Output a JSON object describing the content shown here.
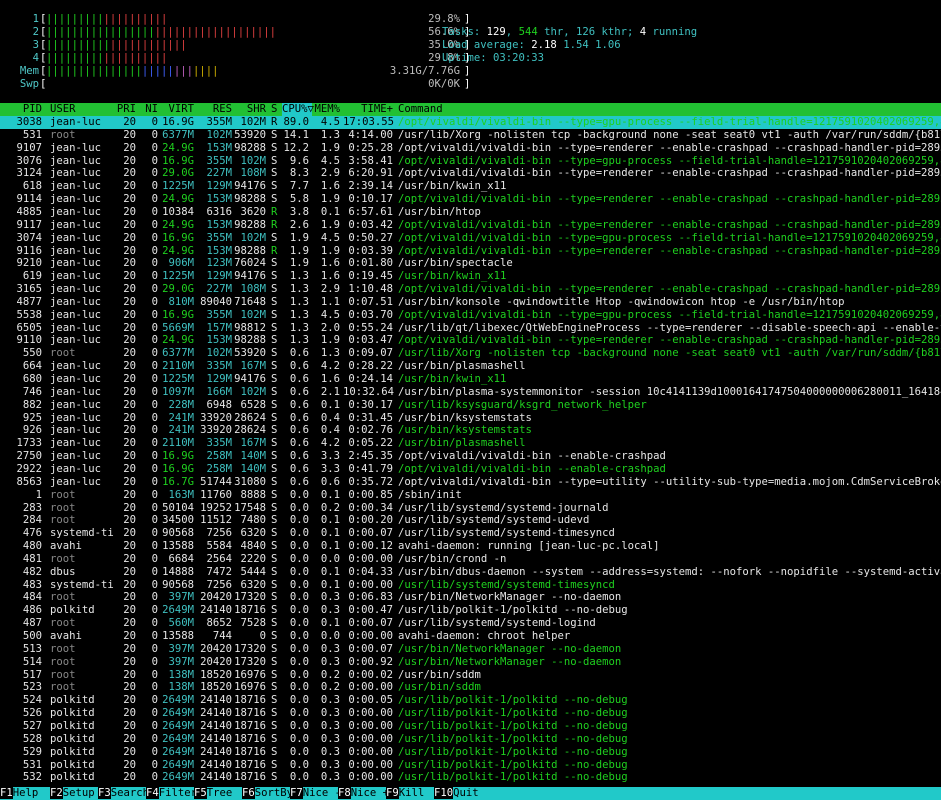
{
  "meters": [
    {
      "label": "1",
      "value": "29.8%"
    },
    {
      "label": "2",
      "value": "56.6%"
    },
    {
      "label": "3",
      "value": "35.0%"
    },
    {
      "label": "4",
      "value": "29.8%"
    },
    {
      "label": "Mem",
      "value": "3.31G/7.76G"
    },
    {
      "label": "Swp",
      "value": "0K/0K"
    }
  ],
  "meter_levels": [
    0.298,
    0.566,
    0.35,
    0.298,
    0.426,
    0.0
  ],
  "stats": {
    "tasks_label": "Tasks: ",
    "tasks": "129",
    "sep1": ", ",
    "thr": "544",
    "thr_label": " thr, ",
    "kthr": "126 kthr; ",
    "running": "4",
    "running_label": " running",
    "load_label": "Load average: ",
    "load1": "2.18",
    "load5": "1.54",
    "load15": "1.06",
    "uptime_label": "Uptime: ",
    "uptime": "03:20:33"
  },
  "header": {
    "pid": "PID",
    "user": "USER",
    "pri": "PRI",
    "ni": "NI",
    "virt": "VIRT",
    "res": "RES",
    "shr": "SHR",
    "s": "S",
    "cpu": "CPU%▽",
    "mem": "MEM%",
    "time": "TIME+",
    "cmd": "Command"
  },
  "processes": [
    [
      "3038",
      "jean-luc",
      "20",
      "0",
      "16.9G",
      "355M",
      "102M",
      "R",
      "89.0",
      "4.5",
      "17:03.55",
      "/opt/vivaldi/vivaldi-bin --type=gpu-process --field-trial-handle=1217591020402069259,8574",
      1
    ],
    [
      "531",
      "root",
      "20",
      "0",
      "6377M",
      "102M",
      "53920",
      "S",
      "14.1",
      "1.3",
      "4:14.00",
      "/usr/lib/Xorg -nolisten tcp -background none -seat seat0 vt1 -auth /var/run/sddm/{b817b8c",
      0
    ],
    [
      "9107",
      "jean-luc",
      "20",
      "0",
      "24.9G",
      "153M",
      "98288",
      "S",
      "12.2",
      "1.9",
      "0:25.28",
      "/opt/vivaldi/vivaldi-bin --type=renderer --enable-crashpad --crashpad-handler-pid=2895 --",
      0
    ],
    [
      "3076",
      "jean-luc",
      "20",
      "0",
      "16.9G",
      "355M",
      "102M",
      "S",
      "9.6",
      "4.5",
      "3:58.41",
      "/opt/vivaldi/vivaldi-bin --type=gpu-process --field-trial-handle=1217591020402069259,8574",
      1
    ],
    [
      "3124",
      "jean-luc",
      "20",
      "0",
      "29.0G",
      "227M",
      "108M",
      "S",
      "8.3",
      "2.9",
      "6:20.91",
      "/opt/vivaldi/vivaldi-bin --type=renderer --enable-crashpad --crashpad-handler-pid=2895 --",
      0
    ],
    [
      "618",
      "jean-luc",
      "20",
      "0",
      "1225M",
      "129M",
      "94176",
      "S",
      "7.7",
      "1.6",
      "2:39.14",
      "/usr/bin/kwin_x11",
      0
    ],
    [
      "9114",
      "jean-luc",
      "20",
      "0",
      "24.9G",
      "153M",
      "98288",
      "S",
      "5.8",
      "1.9",
      "0:10.17",
      "/opt/vivaldi/vivaldi-bin --type=renderer --enable-crashpad --crashpad-handler-pid=2895 --",
      1
    ],
    [
      "4885",
      "jean-luc",
      "20",
      "0",
      "10384",
      "6316",
      "3620",
      "R",
      "3.8",
      "0.1",
      "6:57.61",
      "/usr/bin/htop",
      0
    ],
    [
      "9117",
      "jean-luc",
      "20",
      "0",
      "24.9G",
      "153M",
      "98288",
      "R",
      "2.6",
      "1.9",
      "0:03.42",
      "/opt/vivaldi/vivaldi-bin --type=renderer --enable-crashpad --crashpad-handler-pid=2895 --",
      1
    ],
    [
      "3074",
      "jean-luc",
      "20",
      "0",
      "16.9G",
      "355M",
      "102M",
      "S",
      "1.9",
      "4.5",
      "0:50.27",
      "/opt/vivaldi/vivaldi-bin --type=gpu-process --field-trial-handle=1217591020402069259,8574",
      1
    ],
    [
      "9116",
      "jean-luc",
      "20",
      "0",
      "24.9G",
      "153M",
      "98288",
      "R",
      "1.9",
      "1.9",
      "0:03.39",
      "/opt/vivaldi/vivaldi-bin --type=renderer --enable-crashpad --crashpad-handler-pid=2895 --",
      1
    ],
    [
      "9210",
      "jean-luc",
      "20",
      "0",
      "906M",
      "123M",
      "76024",
      "S",
      "1.9",
      "1.6",
      "0:01.80",
      "/usr/bin/spectacle",
      0
    ],
    [
      "619",
      "jean-luc",
      "20",
      "0",
      "1225M",
      "129M",
      "94176",
      "S",
      "1.3",
      "1.6",
      "0:19.45",
      "/usr/bin/kwin_x11",
      1
    ],
    [
      "3165",
      "jean-luc",
      "20",
      "0",
      "29.0G",
      "227M",
      "108M",
      "S",
      "1.3",
      "2.9",
      "1:10.48",
      "/opt/vivaldi/vivaldi-bin --type=renderer --enable-crashpad --crashpad-handler-pid=2895 --",
      1
    ],
    [
      "4877",
      "jean-luc",
      "20",
      "0",
      "810M",
      "89040",
      "71648",
      "S",
      "1.3",
      "1.1",
      "0:07.51",
      "/usr/bin/konsole -qwindowtitle Htop -qwindowicon htop -e /usr/bin/htop",
      0
    ],
    [
      "5538",
      "jean-luc",
      "20",
      "0",
      "16.9G",
      "355M",
      "102M",
      "S",
      "1.3",
      "4.5",
      "0:03.70",
      "/opt/vivaldi/vivaldi-bin --type=gpu-process --field-trial-handle=1217591020402069259,8574",
      1
    ],
    [
      "6505",
      "jean-luc",
      "20",
      "0",
      "5669M",
      "157M",
      "98812",
      "S",
      "1.3",
      "2.0",
      "0:55.24",
      "/usr/lib/qt/libexec/QtWebEngineProcess --type=renderer --disable-speech-api --enable-thre",
      0
    ],
    [
      "9110",
      "jean-luc",
      "20",
      "0",
      "24.9G",
      "153M",
      "98288",
      "S",
      "1.3",
      "1.9",
      "0:03.47",
      "/opt/vivaldi/vivaldi-bin --type=renderer --enable-crashpad --crashpad-handler-pid=2895 --",
      1
    ],
    [
      "550",
      "root",
      "20",
      "0",
      "6377M",
      "102M",
      "53920",
      "S",
      "0.6",
      "1.3",
      "0:09.07",
      "/usr/lib/Xorg -nolisten tcp -background none -seat seat0 vt1 -auth /var/run/sddm/{b817b8c",
      1
    ],
    [
      "664",
      "jean-luc",
      "20",
      "0",
      "2110M",
      "335M",
      "167M",
      "S",
      "0.6",
      "4.2",
      "0:28.22",
      "/usr/bin/plasmashell",
      0
    ],
    [
      "680",
      "jean-luc",
      "20",
      "0",
      "1225M",
      "129M",
      "94176",
      "S",
      "0.6",
      "1.6",
      "0:24.14",
      "/usr/bin/kwin_x11",
      1
    ],
    [
      "746",
      "jean-luc",
      "20",
      "0",
      "1097M",
      "166M",
      "102M",
      "S",
      "0.6",
      "2.1",
      "10:32.64",
      "/usr/bin/plasma-systemmonitor -session 10c4141139d10001641747504000000006280011_1641840747",
      0
    ],
    [
      "882",
      "jean-luc",
      "20",
      "0",
      "228M",
      "6948",
      "6528",
      "S",
      "0.6",
      "0.1",
      "0:30.17",
      "/usr/lib/ksysguard/ksgrd_network_helper",
      1
    ],
    [
      "925",
      "jean-luc",
      "20",
      "0",
      "241M",
      "33920",
      "28624",
      "S",
      "0.6",
      "0.4",
      "0:31.45",
      "/usr/bin/ksystemstats",
      0
    ],
    [
      "926",
      "jean-luc",
      "20",
      "0",
      "241M",
      "33920",
      "28624",
      "S",
      "0.6",
      "0.4",
      "0:02.76",
      "/usr/bin/ksystemstats",
      1
    ],
    [
      "1733",
      "jean-luc",
      "20",
      "0",
      "2110M",
      "335M",
      "167M",
      "S",
      "0.6",
      "4.2",
      "0:05.22",
      "/usr/bin/plasmashell",
      1
    ],
    [
      "2750",
      "jean-luc",
      "20",
      "0",
      "16.9G",
      "258M",
      "140M",
      "S",
      "0.6",
      "3.3",
      "2:45.35",
      "/opt/vivaldi/vivaldi-bin --enable-crashpad",
      0
    ],
    [
      "2922",
      "jean-luc",
      "20",
      "0",
      "16.9G",
      "258M",
      "140M",
      "S",
      "0.6",
      "3.3",
      "0:41.79",
      "/opt/vivaldi/vivaldi-bin --enable-crashpad",
      1
    ],
    [
      "8563",
      "jean-luc",
      "20",
      "0",
      "16.7G",
      "51744",
      "31080",
      "S",
      "0.6",
      "0.6",
      "0:35.72",
      "/opt/vivaldi/vivaldi-bin --type=utility --utility-sub-type=media.mojom.CdmServiceBroker -",
      0
    ],
    [
      "1",
      "root",
      "20",
      "0",
      "163M",
      "11760",
      "8888",
      "S",
      "0.0",
      "0.1",
      "0:00.85",
      "/sbin/init",
      0
    ],
    [
      "283",
      "root",
      "20",
      "0",
      "50104",
      "19252",
      "17548",
      "S",
      "0.0",
      "0.2",
      "0:00.34",
      "/usr/lib/systemd/systemd-journald",
      0
    ],
    [
      "284",
      "root",
      "20",
      "0",
      "34500",
      "11512",
      "7480",
      "S",
      "0.0",
      "0.1",
      "0:00.20",
      "/usr/lib/systemd/systemd-udevd",
      0
    ],
    [
      "476",
      "systemd-ti",
      "20",
      "0",
      "90568",
      "7256",
      "6320",
      "S",
      "0.0",
      "0.1",
      "0:00.07",
      "/usr/lib/systemd/systemd-timesyncd",
      0
    ],
    [
      "480",
      "avahi",
      "20",
      "0",
      "13588",
      "5584",
      "4840",
      "S",
      "0.0",
      "0.1",
      "0:00.12",
      "avahi-daemon: running [jean-luc-pc.local]",
      0
    ],
    [
      "481",
      "root",
      "20",
      "0",
      "6684",
      "2564",
      "2220",
      "S",
      "0.0",
      "0.0",
      "0:00.00",
      "/usr/bin/crond -n",
      0
    ],
    [
      "482",
      "dbus",
      "20",
      "0",
      "14888",
      "7472",
      "5444",
      "S",
      "0.0",
      "0.1",
      "0:04.33",
      "/usr/bin/dbus-daemon --system --address=systemd: --nofork --nopidfile --systemd-activatio",
      0
    ],
    [
      "483",
      "systemd-ti",
      "20",
      "0",
      "90568",
      "7256",
      "6320",
      "S",
      "0.0",
      "0.1",
      "0:00.00",
      "/usr/lib/systemd/systemd-timesyncd",
      1
    ],
    [
      "484",
      "root",
      "20",
      "0",
      "397M",
      "20420",
      "17320",
      "S",
      "0.0",
      "0.3",
      "0:06.83",
      "/usr/bin/NetworkManager --no-daemon",
      0
    ],
    [
      "486",
      "polkitd",
      "20",
      "0",
      "2649M",
      "24140",
      "18716",
      "S",
      "0.0",
      "0.3",
      "0:00.47",
      "/usr/lib/polkit-1/polkitd --no-debug",
      0
    ],
    [
      "487",
      "root",
      "20",
      "0",
      "560M",
      "8652",
      "7528",
      "S",
      "0.0",
      "0.1",
      "0:00.07",
      "/usr/lib/systemd/systemd-logind",
      0
    ],
    [
      "500",
      "avahi",
      "20",
      "0",
      "13588",
      "744",
      "0",
      "S",
      "0.0",
      "0.0",
      "0:00.00",
      "avahi-daemon: chroot helper",
      0
    ],
    [
      "513",
      "root",
      "20",
      "0",
      "397M",
      "20420",
      "17320",
      "S",
      "0.0",
      "0.3",
      "0:00.07",
      "/usr/bin/NetworkManager --no-daemon",
      1
    ],
    [
      "514",
      "root",
      "20",
      "0",
      "397M",
      "20420",
      "17320",
      "S",
      "0.0",
      "0.3",
      "0:00.92",
      "/usr/bin/NetworkManager --no-daemon",
      1
    ],
    [
      "517",
      "root",
      "20",
      "0",
      "138M",
      "18520",
      "16976",
      "S",
      "0.0",
      "0.2",
      "0:00.02",
      "/usr/bin/sddm",
      0
    ],
    [
      "523",
      "root",
      "20",
      "0",
      "138M",
      "18520",
      "16976",
      "S",
      "0.0",
      "0.2",
      "0:00.00",
      "/usr/bin/sddm",
      1
    ],
    [
      "524",
      "polkitd",
      "20",
      "0",
      "2649M",
      "24140",
      "18716",
      "S",
      "0.0",
      "0.3",
      "0:00.05",
      "/usr/lib/polkit-1/polkitd --no-debug",
      1
    ],
    [
      "526",
      "polkitd",
      "20",
      "0",
      "2649M",
      "24140",
      "18716",
      "S",
      "0.0",
      "0.3",
      "0:00.00",
      "/usr/lib/polkit-1/polkitd --no-debug",
      1
    ],
    [
      "527",
      "polkitd",
      "20",
      "0",
      "2649M",
      "24140",
      "18716",
      "S",
      "0.0",
      "0.3",
      "0:00.00",
      "/usr/lib/polkit-1/polkitd --no-debug",
      1
    ],
    [
      "528",
      "polkitd",
      "20",
      "0",
      "2649M",
      "24140",
      "18716",
      "S",
      "0.0",
      "0.3",
      "0:00.00",
      "/usr/lib/polkit-1/polkitd --no-debug",
      1
    ],
    [
      "529",
      "polkitd",
      "20",
      "0",
      "2649M",
      "24140",
      "18716",
      "S",
      "0.0",
      "0.3",
      "0:00.00",
      "/usr/lib/polkit-1/polkitd --no-debug",
      1
    ],
    [
      "531",
      "polkitd",
      "20",
      "0",
      "2649M",
      "24140",
      "18716",
      "S",
      "0.0",
      "0.3",
      "0:00.00",
      "/usr/lib/polkit-1/polkitd --no-debug",
      1
    ],
    [
      "532",
      "polkitd",
      "20",
      "0",
      "2649M",
      "24140",
      "18716",
      "S",
      "0.0",
      "0.3",
      "0:00.00",
      "/usr/lib/polkit-1/polkitd --no-debug",
      1
    ]
  ],
  "footer": [
    {
      "key": "F1",
      "label": "Help  "
    },
    {
      "key": "F2",
      "label": "Setup "
    },
    {
      "key": "F3",
      "label": "Search"
    },
    {
      "key": "F4",
      "label": "Filter"
    },
    {
      "key": "F5",
      "label": "Tree  "
    },
    {
      "key": "F6",
      "label": "SortBy"
    },
    {
      "key": "F7",
      "label": "Nice -"
    },
    {
      "key": "F8",
      "label": "Nice +"
    },
    {
      "key": "F9",
      "label": "Kill  "
    },
    {
      "key": "F10",
      "label": "Quit"
    }
  ],
  "colors": {
    "selected_row": "#21c9c9",
    "header": "#22c033",
    "thread": "#1fd01f",
    "footer": "#21c9c9"
  }
}
